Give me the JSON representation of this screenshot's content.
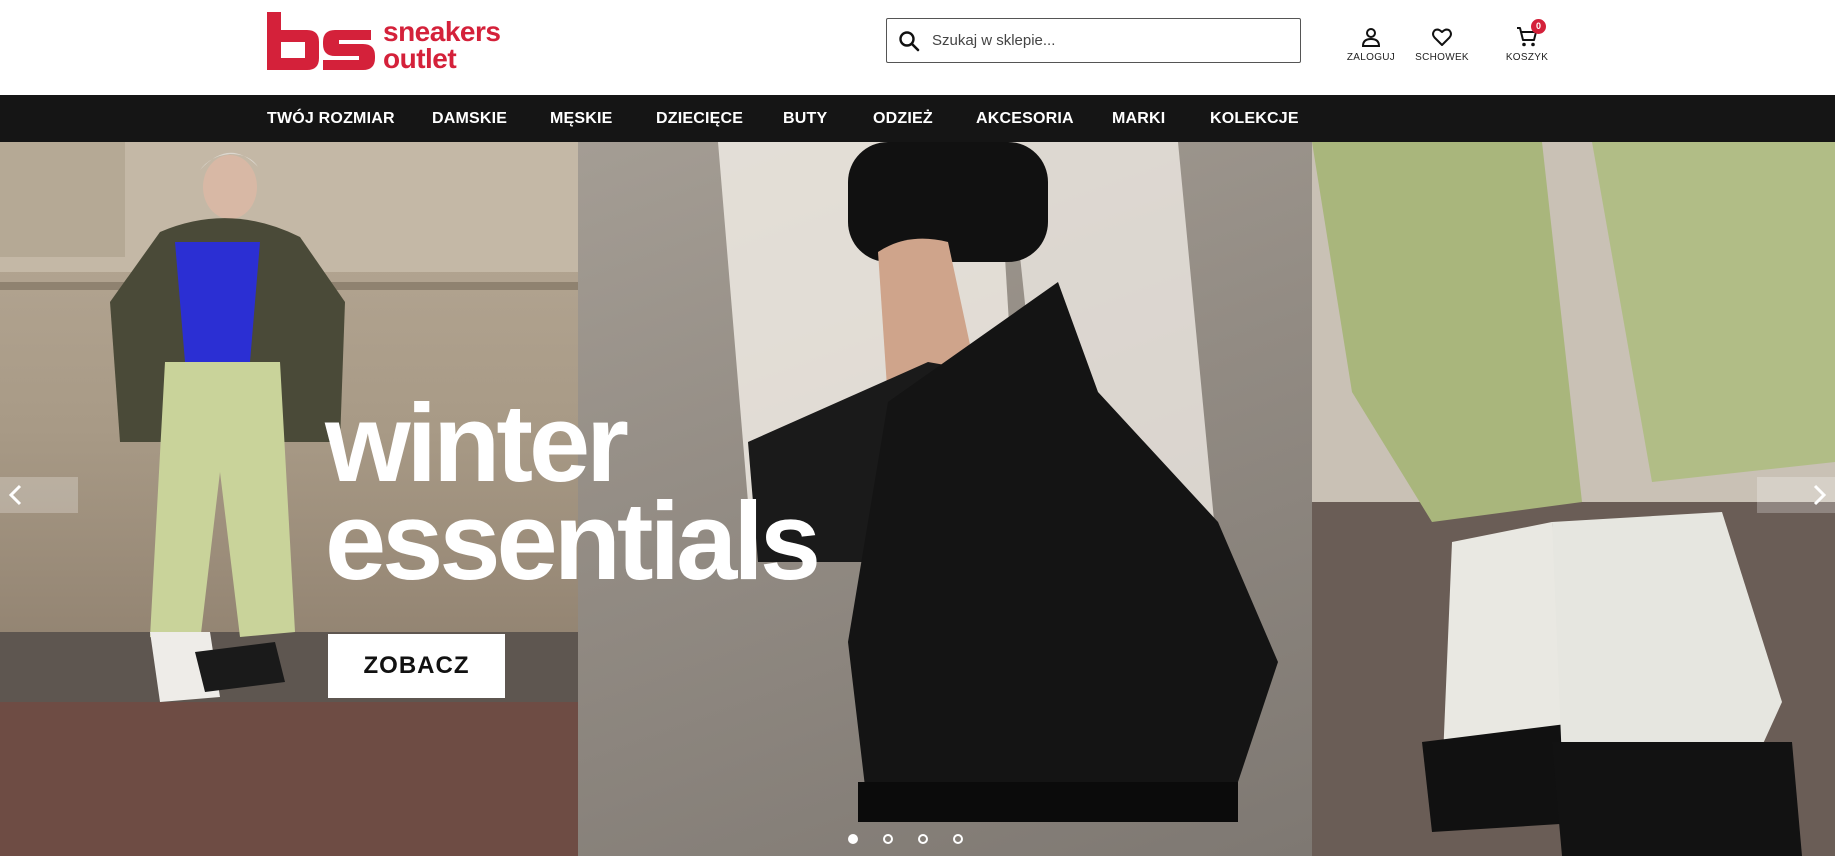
{
  "brand": {
    "name_line1": "sneakers",
    "name_line2": "outlet",
    "color": "#d4213a"
  },
  "search": {
    "placeholder": "Szukaj w sklepie...",
    "value": "",
    "icon": "search-icon"
  },
  "header_actions": [
    {
      "label": "ZALOGUJ",
      "icon": "user-icon"
    },
    {
      "label": "SCHOWEK",
      "icon": "heart-icon"
    },
    {
      "label": "KOSZYK",
      "icon": "cart-icon",
      "badge": "0"
    }
  ],
  "nav": {
    "items": [
      "TWÓJ ROZMIAR",
      "DAMSKIE",
      "MĘSKIE",
      "DZIECIĘCE",
      "BUTY",
      "ODZIEŻ",
      "AKCESORIA",
      "MARKI",
      "KOLEKCJE"
    ]
  },
  "hero": {
    "title_line1": "winter",
    "title_line2": "essentials",
    "cta": "ZOBACZ",
    "slide_count": 4,
    "active_slide": 1
  },
  "colors": {
    "nav_bg": "#151515",
    "accent": "#d4213a"
  }
}
